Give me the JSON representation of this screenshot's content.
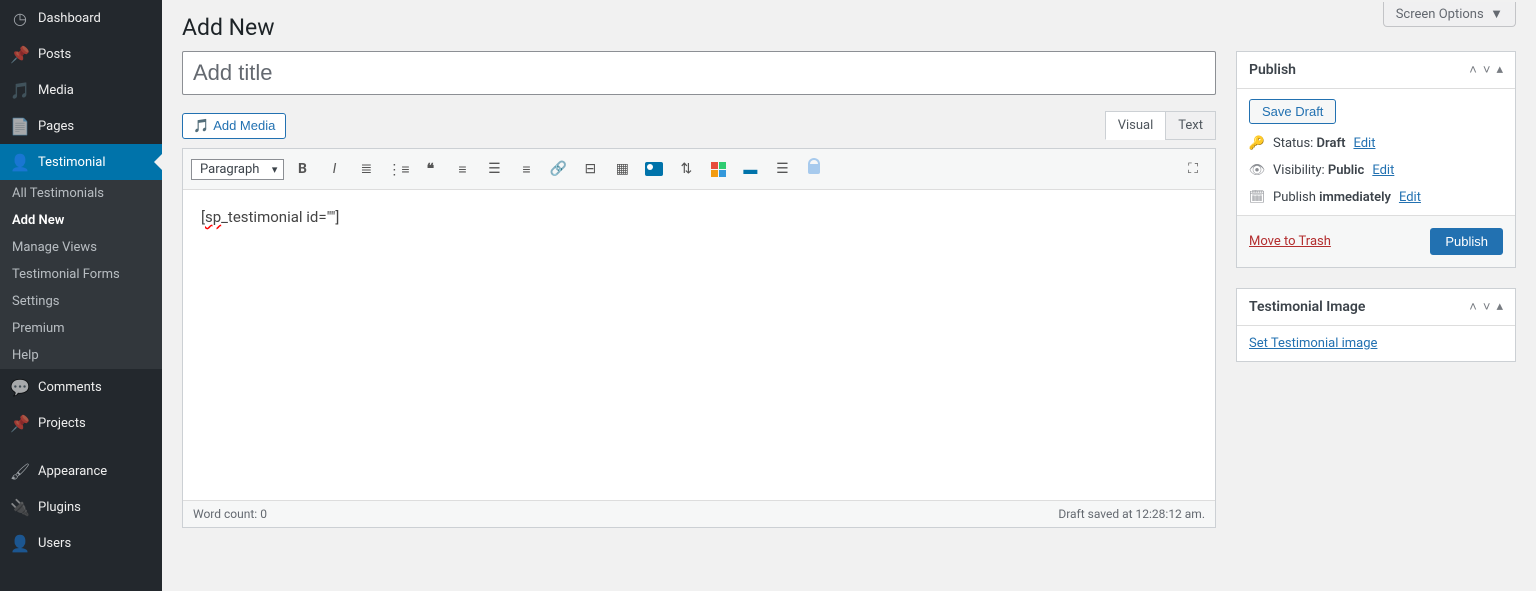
{
  "screen_options": "Screen Options",
  "sidebar": {
    "items": [
      {
        "label": "Dashboard"
      },
      {
        "label": "Posts"
      },
      {
        "label": "Media"
      },
      {
        "label": "Pages"
      },
      {
        "label": "Testimonial"
      },
      {
        "label": "Comments"
      },
      {
        "label": "Projects"
      },
      {
        "label": "Appearance"
      },
      {
        "label": "Plugins"
      },
      {
        "label": "Users"
      }
    ],
    "sub_items": [
      {
        "label": "All Testimonials"
      },
      {
        "label": "Add New"
      },
      {
        "label": "Manage Views"
      },
      {
        "label": "Testimonial Forms"
      },
      {
        "label": "Settings"
      },
      {
        "label": "Premium"
      },
      {
        "label": "Help"
      }
    ]
  },
  "page_title": "Add New",
  "title_placeholder": "Add title",
  "add_media": "Add Media",
  "tabs": {
    "visual": "Visual",
    "text": "Text"
  },
  "format_select": "Paragraph",
  "editor_content_prefix": "[",
  "editor_content_sp": "sp",
  "editor_content_suffix": "_testimonial id=\"\"]",
  "word_count_label": "Word count: ",
  "word_count_value": "0",
  "draft_saved": "Draft saved at 12:28:12 am.",
  "publish_box": {
    "title": "Publish",
    "save_draft": "Save Draft",
    "status_label": "Status: ",
    "status_value": "Draft",
    "visibility_label": "Visibility: ",
    "visibility_value": "Public",
    "schedule_label": "Publish ",
    "schedule_value": "immediately",
    "edit": "Edit",
    "trash": "Move to Trash",
    "publish": "Publish"
  },
  "image_box": {
    "title": "Testimonial Image",
    "set_link": "Set Testimonial image"
  }
}
